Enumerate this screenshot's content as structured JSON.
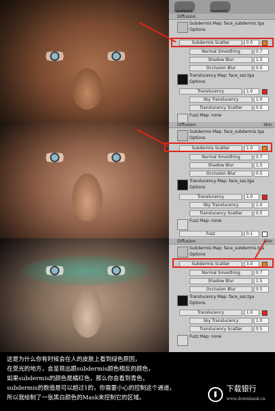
{
  "top_strip": {
    "item1": "NewMat01",
    "item2": "NewMat02"
  },
  "panels": [
    {
      "diffusion_header": "Diffusion:",
      "subdermis_map_label": "Subdermis Map: face_subdermis.tga",
      "options_label": "Options",
      "subdermis_scatter_label": "Subdermis Scatter",
      "subdermis_scatter_value": "0.0",
      "normal_smoothing_label": "Normal Smoothing",
      "normal_smoothing_value": "0.7",
      "shadow_blur_label": "Shadow Blur",
      "shadow_blur_value": "1.5",
      "occlusion_blur_label": "Occlusion Blur",
      "occlusion_blur_value": "0.5",
      "translucency_map_label": "Translucency Map: face_sss.tga",
      "translucency_label": "Translucency",
      "translucency_value": "1.0",
      "sky_translucency_label": "Sky Translucency",
      "sky_translucency_value": "1.0",
      "translucency_scatter_label": "Translucency Scatter",
      "translucency_scatter_value": "0.5",
      "fuzz_map_label": "Fuzz Map: none"
    },
    {
      "diffusion_header": "Diffusion:",
      "skin_label": "Skin",
      "subdermis_map_label": "Subdermis Map: face_subdermis.tga",
      "options_label": "Options",
      "subdermis_scatter_label": "Subdermis Scatter",
      "subdermis_scatter_value": "1.0",
      "normal_smoothing_label": "Normal Smoothing",
      "normal_smoothing_value": "0.7",
      "shadow_blur_label": "Shadow Blur",
      "shadow_blur_value": "1.5",
      "occlusion_blur_label": "Occlusion Blur",
      "occlusion_blur_value": "0.5",
      "translucency_map_label": "Translucency Map: face_sss.tga",
      "translucency_label": "Translucency",
      "translucency_value": "1.0",
      "sky_translucency_label": "Sky Translucency",
      "sky_translucency_value": "1.0",
      "translucency_scatter_label": "Translucency Scatter",
      "translucency_scatter_value": "0.5",
      "fuzz_map_label": "Fuzz Map: none",
      "fuzz_label": "Fuzz",
      "fuzz_value": "0.1"
    },
    {
      "diffusion_header": "Diffusion:",
      "skin_label": "Skin",
      "subdermis_map_label": "Subdermis Map: face_subdermis.tga",
      "options_label": "Options",
      "subdermis_scatter_label": "Subdermis Scatter",
      "subdermis_scatter_value": "3.0",
      "normal_smoothing_label": "Normal Smoothing",
      "normal_smoothing_value": "0.7",
      "shadow_blur_label": "Shadow Blur",
      "shadow_blur_value": "1.5",
      "occlusion_blur_label": "Occlusion Blur",
      "occlusion_blur_value": "0.5",
      "translucency_map_label": "Translucency Map: face_sss.tga",
      "translucency_label": "Translucency",
      "translucency_value": "1.0",
      "sky_translucency_label": "Sky Translucency",
      "sky_translucency_value": "1.0",
      "translucency_scatter_label": "Translucency Scatter",
      "translucency_scatter_value": "0.5",
      "fuzz_map_label": "Fuzz Map: none"
    }
  ],
  "caption": {
    "line1": "这是为什么你有时候会在人的皮肤上看到绿色原因，",
    "line2": "在受光的地方，会呈现出跟subdermis颜色相反的颜色，",
    "line3": "如果subdermis的颜色是橘红色，那么你会看到青色，",
    "line4": "subdermis的数值是可以超过1的，你需要小心的控制这个通道，",
    "line5": "所以我绘制了一张黑白颜色的Mask来控制它的区域。"
  },
  "watermark": {
    "text": "下载银行",
    "sub": "www.downbank.cn"
  },
  "colors": {
    "orange": "#f07a1a",
    "red": "#e2231a",
    "white": "#ffffff",
    "highlight": "#e2231a"
  }
}
